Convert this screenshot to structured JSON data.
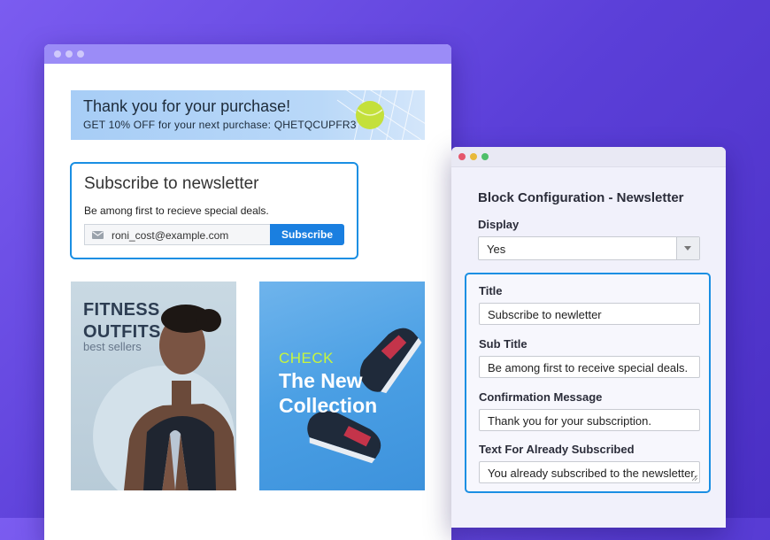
{
  "storefront": {
    "banner": {
      "title": "Thank you for your purchase!",
      "coupon_text": "GET 10% OFF for your next purchase: QHETQCUPFR3"
    },
    "newsletter": {
      "title": "Subscribe to newsletter",
      "subtitle": "Be among first to recieve special deals.",
      "email_value": "roni_cost@example.com",
      "subscribe_label": "Subscribe"
    },
    "promo_fitness": {
      "line1": "FITNESS",
      "line2": "OUTFITS",
      "line3": "best sellers"
    },
    "promo_collection": {
      "line1": "CHECK",
      "line2": "The New",
      "line3": "Collection"
    }
  },
  "config": {
    "title": "Block Configuration - Newsletter",
    "display_label": "Display",
    "display_value": "Yes",
    "fields": [
      {
        "label": "Title",
        "value": "Subscribe to newletter"
      },
      {
        "label": "Sub Title",
        "value": "Be among first to receive special deals."
      },
      {
        "label": "Confirmation Message",
        "value": "Thank you for your subscription."
      },
      {
        "label": "Text For Already Subscribed",
        "value": "You already subscribed to the newsletter."
      }
    ]
  },
  "colors": {
    "accent": "#1a7fe0",
    "background": "#5b3fd8",
    "lime": "#c7f53d",
    "window_dots": [
      "#e5566b",
      "#e8b93b",
      "#4fbf6a"
    ]
  },
  "icons": [
    "mail-icon",
    "chevron-down-icon",
    "resize-grip-icon"
  ]
}
